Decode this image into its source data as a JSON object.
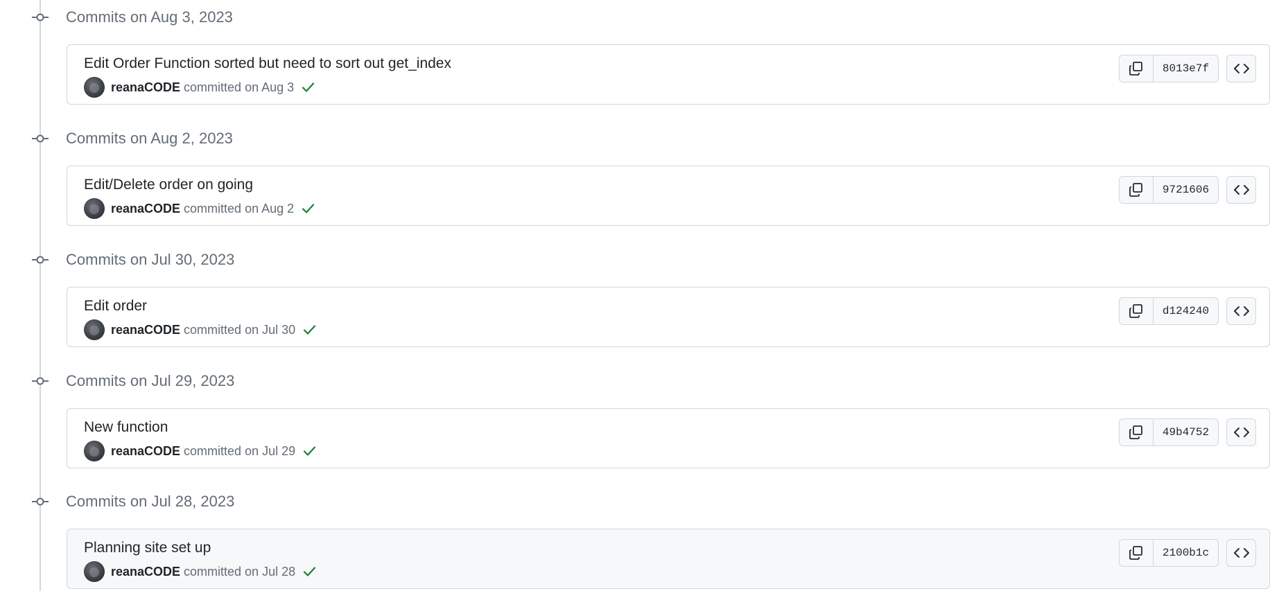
{
  "groups": [
    {
      "title": "Commits on Aug 3, 2023",
      "commit": {
        "message": "Edit Order Function sorted but need to sort out get_index",
        "author": "reanaCODE",
        "committed": "committed on Aug 3",
        "sha": "8013e7f",
        "status": "success"
      }
    },
    {
      "title": "Commits on Aug 2, 2023",
      "commit": {
        "message": "Edit/Delete order on going",
        "author": "reanaCODE",
        "committed": "committed on Aug 2",
        "sha": "9721606",
        "status": "success"
      }
    },
    {
      "title": "Commits on Jul 30, 2023",
      "commit": {
        "message": "Edit order",
        "author": "reanaCODE",
        "committed": "committed on Jul 30",
        "sha": "d124240",
        "status": "success"
      }
    },
    {
      "title": "Commits on Jul 29, 2023",
      "commit": {
        "message": "New function",
        "author": "reanaCODE",
        "committed": "committed on Jul 29",
        "sha": "49b4752",
        "status": "success"
      }
    },
    {
      "title": "Commits on Jul 28, 2023",
      "commit": {
        "message": "Planning site set up",
        "author": "reanaCODE",
        "committed": "committed on Jul 28",
        "sha": "2100b1c",
        "status": "success"
      }
    }
  ],
  "icons": {
    "timeline": "git-commit-icon",
    "status": "check-icon",
    "copy": "copy-icon",
    "browse": "code-icon"
  },
  "colors": {
    "success": "#1a7f37",
    "muted_text": "#636c76",
    "border": "#d0d7de",
    "button_bg": "#f6f8fa"
  }
}
